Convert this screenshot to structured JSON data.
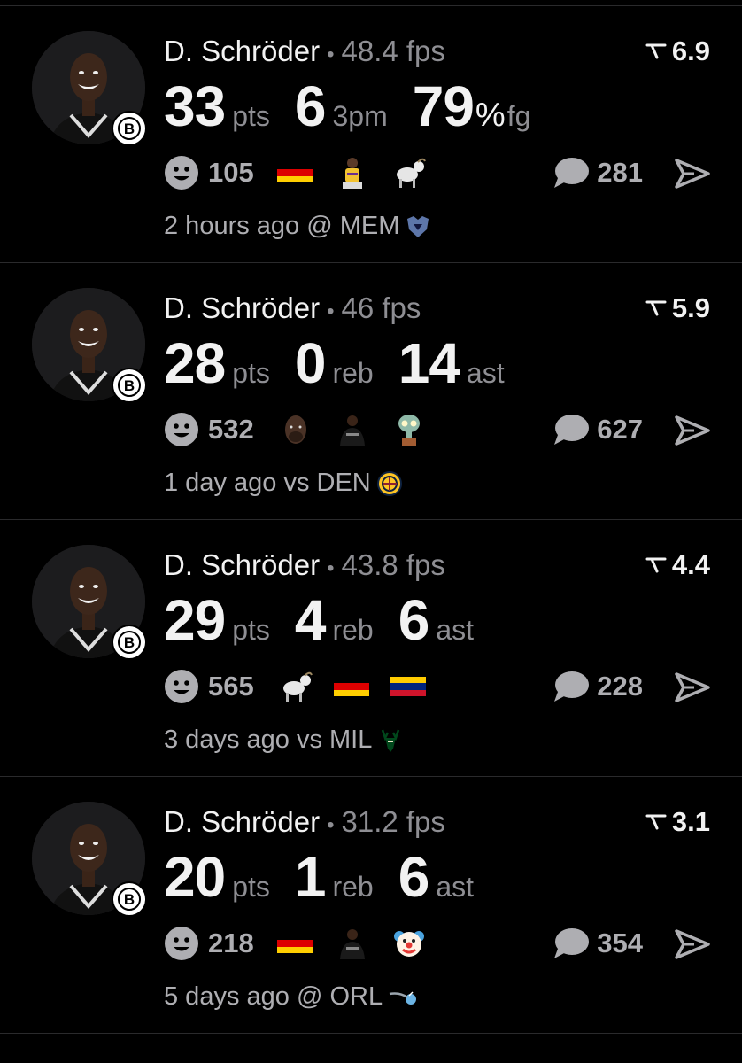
{
  "posts": [
    {
      "player": "D. Schröder",
      "fps": "48.4 fps",
      "score": "6.9",
      "stats": [
        {
          "value": "33",
          "unit": "pts"
        },
        {
          "value": "6",
          "unit": "3pm"
        },
        {
          "value": "79",
          "pct": "%",
          "unit": "fg"
        }
      ],
      "reaction_count": "105",
      "reactions": [
        "flag-germany",
        "player-emoji",
        "goat-emoji"
      ],
      "comment_count": "281",
      "meta": "2 hours ago @ MEM",
      "opponent_logo": "grizzlies-logo"
    },
    {
      "player": "D. Schröder",
      "fps": "46 fps",
      "score": "5.9",
      "stats": [
        {
          "value": "28",
          "unit": "pts"
        },
        {
          "value": "0",
          "unit": "reb"
        },
        {
          "value": "14",
          "unit": "ast"
        }
      ],
      "reaction_count": "532",
      "reactions": [
        "face-emoji",
        "nets-player-emoji",
        "squidward-emoji"
      ],
      "comment_count": "627",
      "meta": "1 day ago vs DEN",
      "opponent_logo": "nuggets-logo"
    },
    {
      "player": "D. Schröder",
      "fps": "43.8 fps",
      "score": "4.4",
      "stats": [
        {
          "value": "29",
          "unit": "pts"
        },
        {
          "value": "4",
          "unit": "reb"
        },
        {
          "value": "6",
          "unit": "ast"
        }
      ],
      "reaction_count": "565",
      "reactions": [
        "goat-emoji",
        "flag-germany",
        "flag-venezuela"
      ],
      "comment_count": "228",
      "meta": "3 days ago vs MIL",
      "opponent_logo": "bucks-logo"
    },
    {
      "player": "D. Schröder",
      "fps": "31.2 fps",
      "score": "3.1",
      "stats": [
        {
          "value": "20",
          "unit": "pts"
        },
        {
          "value": "1",
          "unit": "reb"
        },
        {
          "value": "6",
          "unit": "ast"
        }
      ],
      "reaction_count": "218",
      "reactions": [
        "flag-germany",
        "nets-player-emoji",
        "clown-emoji"
      ],
      "comment_count": "354",
      "meta": "5 days ago @ ORL",
      "opponent_logo": "magic-logo"
    }
  ],
  "colors": {
    "background": "#000000",
    "primary_text": "#f2f2f2",
    "secondary_text": "#8e8e93",
    "divider": "#2a2a2c"
  }
}
